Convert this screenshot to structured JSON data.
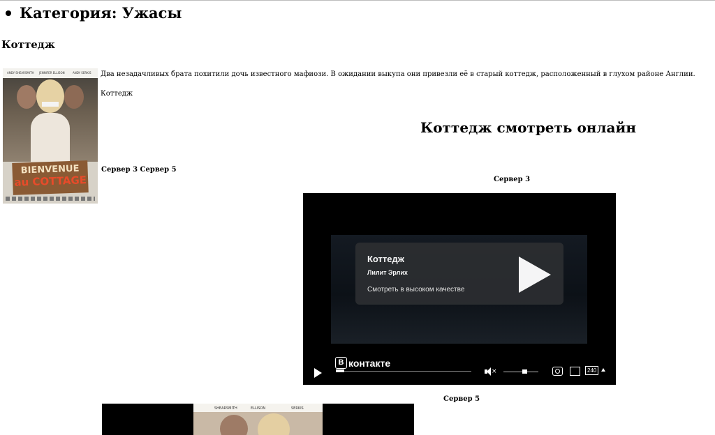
{
  "category": {
    "label": "Категория: Ужасы"
  },
  "movie": {
    "title": "Коттедж",
    "description": "Два незадачливых брата похитили дочь известного мафиози. В ожидании выкупа они привезли её в старый коттедж, расположенный в глухом районе Англии.",
    "alt_title": "Коттедж",
    "servers_line": "Сервер 3 Сервер 5",
    "poster": {
      "actors": [
        "ANDY SHEARSMITH",
        "JENNIFER ELLISON",
        "ANDY SERKIS"
      ],
      "sign_line1": "BIENVENUE",
      "sign_line2": "au COTTAGE"
    }
  },
  "watch": {
    "title": "Коттедж смотреть онлайн"
  },
  "server3": {
    "label": "Сервер 3"
  },
  "server5": {
    "label": "Сервер 5"
  },
  "player": {
    "video_title": "Коттедж",
    "author": "Лилит Эрлих",
    "hq_link": "Смотреть в высоком качестве",
    "brand": "контакте",
    "brand_badge": "В",
    "quality": "240",
    "progress": 0.06,
    "volume": 0.6,
    "mute_glyph": "×"
  },
  "player2": {
    "actors": [
      "SHEARSMITH",
      "ELLISON",
      "SERKIS"
    ]
  }
}
